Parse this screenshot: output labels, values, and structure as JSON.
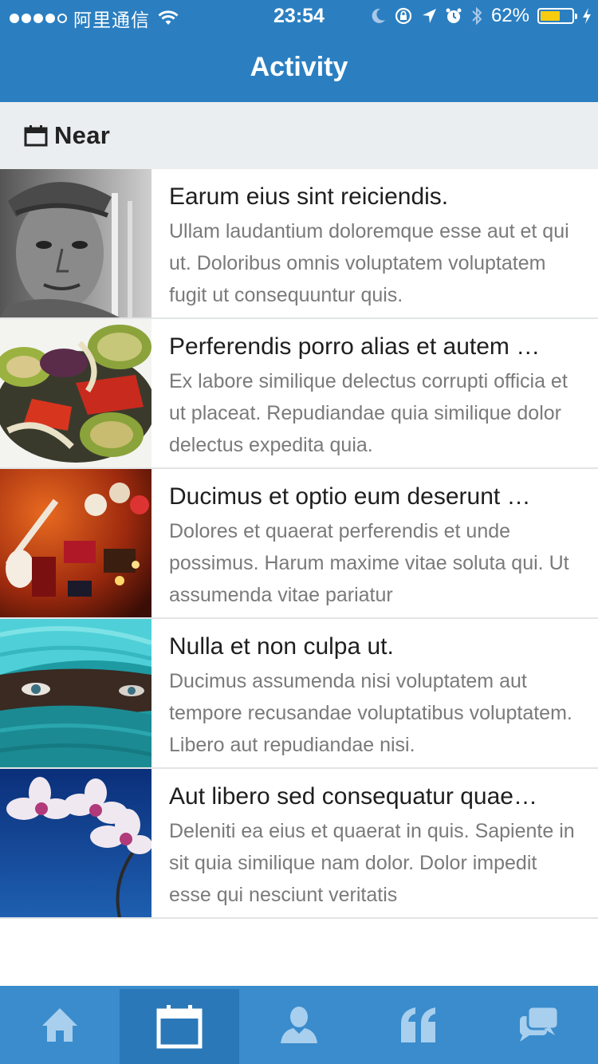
{
  "status_bar": {
    "carrier": "阿里通信",
    "time": "23:54",
    "battery_percent": "62%",
    "battery_level": 0.62
  },
  "nav": {
    "title": "Activity"
  },
  "section": {
    "title": "Near",
    "icon": "calendar-icon"
  },
  "items": [
    {
      "title": "Earum eius sint reiciendis.",
      "description": "Ullam laudantium doloremque esse aut et qui ut. Doloribus omnis voluptatem voluptatem fugit ut consequuntur quis.",
      "image": "portrait-old-man"
    },
    {
      "title": "Perferendis porro alias et autem …",
      "description": "Ex labore similique delectus corrupti officia et ut placeat. Repudiandae quia similique dolor delectus expedita quia.",
      "image": "grilled-vegetables"
    },
    {
      "title": "Ducimus et optio eum deserunt …",
      "description": "Dolores et quaerat perferendis et unde possimus. Harum maxime vitae soluta qui. Ut assumenda vitae pariatur",
      "image": "bar-wall-signs"
    },
    {
      "title": "Nulla et non culpa ut.",
      "description": "Ducimus assumenda nisi voluptatem aut tempore recusandae voluptatibus voluptatem. Libero aut repudiandae nisi.",
      "image": "veiled-face"
    },
    {
      "title": "Aut libero sed consequatur quae…",
      "description": "Deleniti ea eius et quaerat in quis. Sapiente in sit quia similique nam dolor. Dolor impedit esse qui nesciunt veritatis",
      "image": "orchid-flowers"
    }
  ],
  "tabs": [
    {
      "icon": "home-icon",
      "active": false
    },
    {
      "icon": "calendar-icon",
      "active": true
    },
    {
      "icon": "person-icon",
      "active": false
    },
    {
      "icon": "quote-icon",
      "active": false
    },
    {
      "icon": "chat-icon",
      "active": false
    }
  ],
  "colors": {
    "primary": "#2b7fc1",
    "tab_bar": "#3a8ccc",
    "tab_active": "#2a78b8",
    "section_bg": "#ebeef0",
    "battery": "#f5cc0f"
  }
}
